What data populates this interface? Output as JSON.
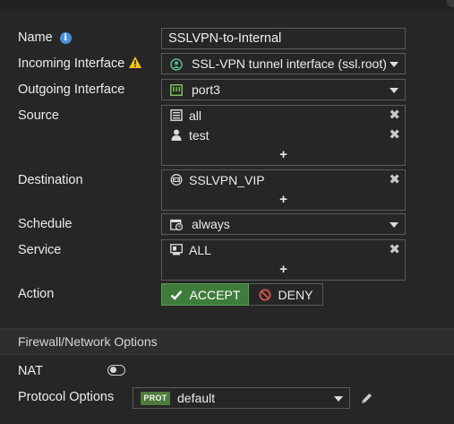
{
  "labels": {
    "name": "Name",
    "incoming": "Incoming Interface",
    "outgoing": "Outgoing Interface",
    "source": "Source",
    "destination": "Destination",
    "schedule": "Schedule",
    "service": "Service",
    "action": "Action",
    "nat": "NAT",
    "protocol_options": "Protocol Options"
  },
  "name_value": "SSLVPN-to-Internal",
  "incoming_value": "SSL-VPN tunnel interface (ssl.root)",
  "outgoing_value": "port3",
  "source_items": [
    "all",
    "test"
  ],
  "destination_items": [
    "SSLVPN_VIP"
  ],
  "schedule_value": "always",
  "service_items": [
    "ALL"
  ],
  "add_symbol": "+",
  "remove_symbol": "✖",
  "action": {
    "accept": "ACCEPT",
    "deny": "DENY",
    "selected": "ACCEPT"
  },
  "section_title": "Firewall/Network Options",
  "nat_enabled": false,
  "protocol_badge": "PROT",
  "protocol_value": "default",
  "colors": {
    "background": "#262626",
    "accent_green": "#3e7c3c",
    "info_blue": "#4a90d9",
    "warning_yellow": "#f0c419",
    "deny_red": "#d9534f"
  },
  "icons": [
    "info-icon",
    "warning-icon",
    "interface-icon",
    "port-icon",
    "address-icon",
    "user-icon",
    "vip-icon",
    "schedule-icon",
    "service-icon",
    "check-icon",
    "deny-icon",
    "toggle-icon",
    "pencil-icon"
  ]
}
